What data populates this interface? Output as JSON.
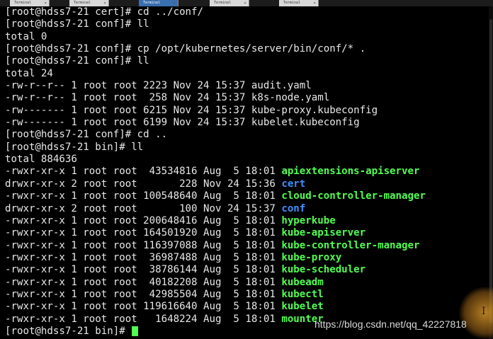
{
  "tabs": [
    "Terminal",
    "Terminal",
    "Terminal",
    "Terminal",
    "Terminal"
  ],
  "terminal_lines": [
    {
      "text": "[root@hdss7-21 cert]# cd ../conf/"
    },
    {
      "text": "[root@hdss7-21 conf]# ll"
    },
    {
      "text": "total 0"
    },
    {
      "text": "[root@hdss7-21 conf]# cp /opt/kubernetes/server/bin/conf/* ."
    },
    {
      "text": "[root@hdss7-21 conf]# ll"
    },
    {
      "text": "total 24"
    },
    {
      "text": "-rw-r--r-- 1 root root 2223 Nov 24 15:37 audit.yaml"
    },
    {
      "text": "-rw-r--r-- 1 root root  258 Nov 24 15:37 k8s-node.yaml"
    },
    {
      "text": "-rw------- 1 root root 6215 Nov 24 15:37 kube-proxy.kubeconfig"
    },
    {
      "text": "-rw------- 1 root root 6199 Nov 24 15:37 kubelet.kubeconfig"
    },
    {
      "text": "[root@hdss7-21 conf]# cd .."
    },
    {
      "text": "[root@hdss7-21 bin]# ll"
    },
    {
      "text": "total 884636"
    },
    {
      "text": "-rwxr-xr-x 1 root root  43534816 Aug  5 18:01 ",
      "name": "apiextensions-apiserver",
      "color": "green"
    },
    {
      "text": "drwxr-xr-x 2 root root       228 Nov 24 15:36 ",
      "name": "cert",
      "color": "blue"
    },
    {
      "text": "-rwxr-xr-x 1 root root 100548640 Aug  5 18:01 ",
      "name": "cloud-controller-manager",
      "color": "green"
    },
    {
      "text": "drwxr-xr-x 2 root root       100 Nov 24 15:37 ",
      "name": "conf",
      "color": "blue"
    },
    {
      "text": "-rwxr-xr-x 1 root root 200648416 Aug  5 18:01 ",
      "name": "hyperkube",
      "color": "green"
    },
    {
      "text": "-rwxr-xr-x 1 root root 164501920 Aug  5 18:01 ",
      "name": "kube-apiserver",
      "color": "green"
    },
    {
      "text": "-rwxr-xr-x 1 root root 116397088 Aug  5 18:01 ",
      "name": "kube-controller-manager",
      "color": "green"
    },
    {
      "text": "-rwxr-xr-x 1 root root  36987488 Aug  5 18:01 ",
      "name": "kube-proxy",
      "color": "green"
    },
    {
      "text": "-rwxr-xr-x 1 root root  38786144 Aug  5 18:01 ",
      "name": "kube-scheduler",
      "color": "green"
    },
    {
      "text": "-rwxr-xr-x 1 root root  40182208 Aug  5 18:01 ",
      "name": "kubeadm",
      "color": "green"
    },
    {
      "text": "-rwxr-xr-x 1 root root  42985504 Aug  5 18:01 ",
      "name": "kubectl",
      "color": "green"
    },
    {
      "text": "-rwxr-xr-x 1 root root 119616640 Aug  5 18:01 ",
      "name": "kubelet",
      "color": "green"
    },
    {
      "text": "-rwxr-xr-x 1 root root   1648224 Aug  5 18:01 ",
      "name": "mounter",
      "color": "green"
    },
    {
      "text": "[root@hdss7-21 bin]# ",
      "cursor": true
    }
  ],
  "watermark": "https://blog.csdn.net/qq_42227818",
  "colors": {
    "background": "#000000",
    "text": "#e8e8e8",
    "directory": "#3f8fff",
    "executable": "#50ff50",
    "cursor": "#50ff50"
  },
  "icons": {
    "mouse_cursor": "text-ibeam-icon",
    "tab_close": "close-icon"
  }
}
